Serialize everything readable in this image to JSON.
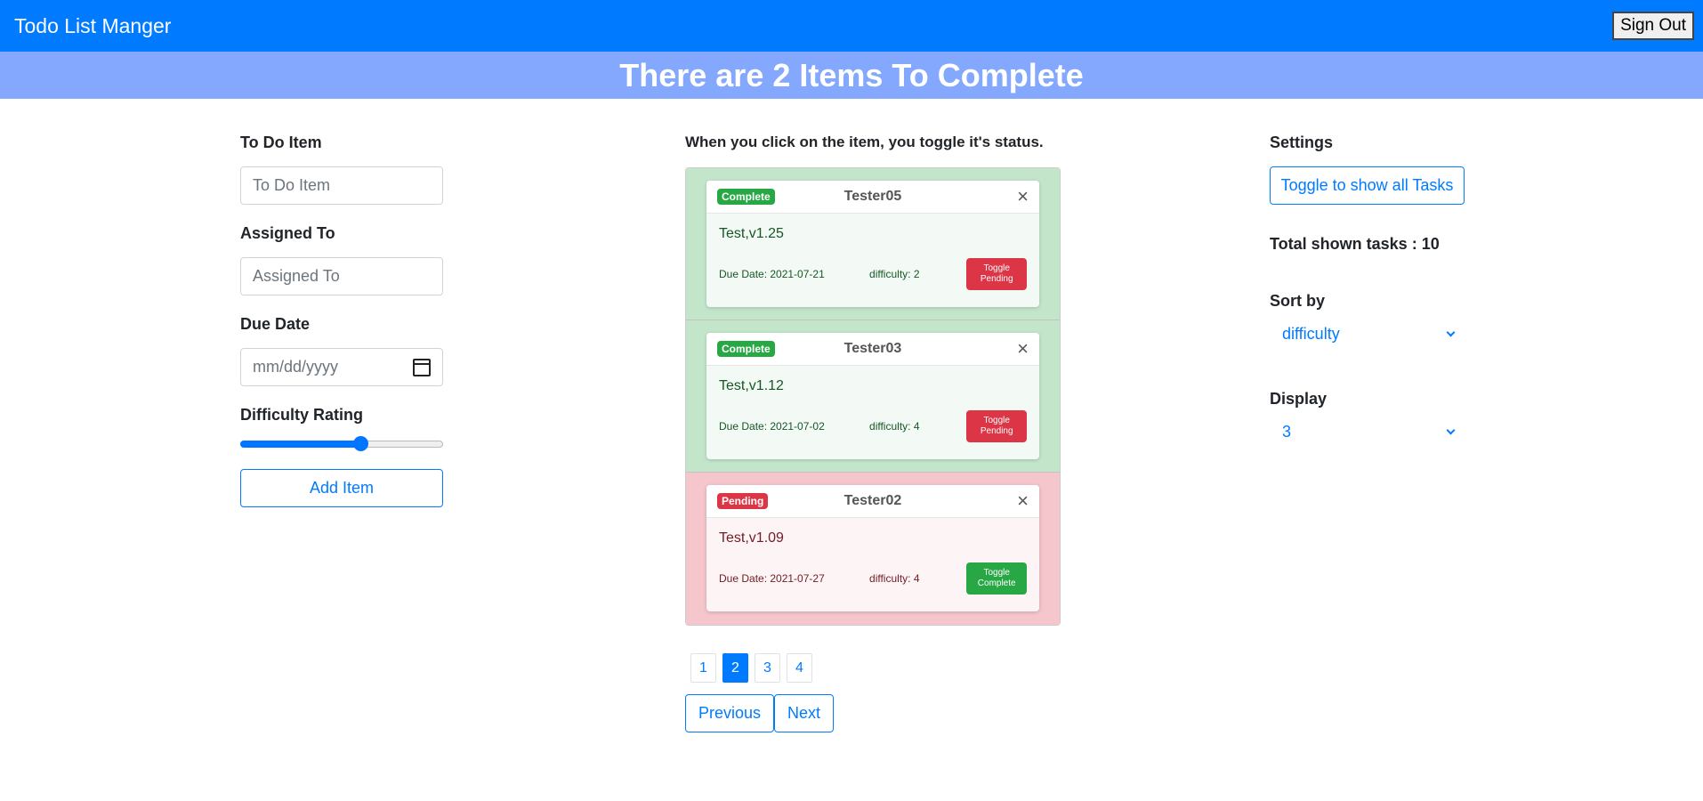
{
  "app": {
    "title": "Todo List Manger",
    "sign_out": "Sign Out"
  },
  "banner": {
    "text": "There are 2 Items To Complete"
  },
  "form": {
    "item_label": "To Do Item",
    "item_placeholder": "To Do Item",
    "assigned_label": "Assigned To",
    "assigned_placeholder": "Assigned To",
    "due_label": "Due Date",
    "due_placeholder": "mm/dd/yyyy",
    "difficulty_label": "Difficulty Rating",
    "difficulty_value": 0.6,
    "add_button": "Add Item"
  },
  "list": {
    "hint": "When you click on the item, you toggle it's status.",
    "items": [
      {
        "status": "Complete",
        "assignee": "Tester05",
        "text": "Test,v1.25",
        "due": "Due Date: 2021-07-21",
        "difficulty": "difficulty: 2",
        "toggle": "Toggle Pending",
        "close": "×"
      },
      {
        "status": "Complete",
        "assignee": "Tester03",
        "text": "Test,v1.12",
        "due": "Due Date: 2021-07-02",
        "difficulty": "difficulty: 4",
        "toggle": "Toggle Pending",
        "close": "×"
      },
      {
        "status": "Pending",
        "assignee": "Tester02",
        "text": "Test,v1.09",
        "due": "Due Date: 2021-07-27",
        "difficulty": "difficulty: 4",
        "toggle": "Toggle Complete",
        "close": "×"
      }
    ],
    "pages": [
      "1",
      "2",
      "3",
      "4"
    ],
    "active_page": "2",
    "previous": "Previous",
    "next": "Next"
  },
  "settings": {
    "title": "Settings",
    "toggle_button": "Toggle to show all Tasks",
    "total": "Total shown tasks : 10",
    "sort_label": "Sort by",
    "sort_value": "difficulty",
    "display_label": "Display",
    "display_value": "3"
  },
  "colors": {
    "primary": "#007bff",
    "banner": "#85a8ff",
    "complete": "#c3e6cb",
    "pending": "#f5c6cb"
  }
}
